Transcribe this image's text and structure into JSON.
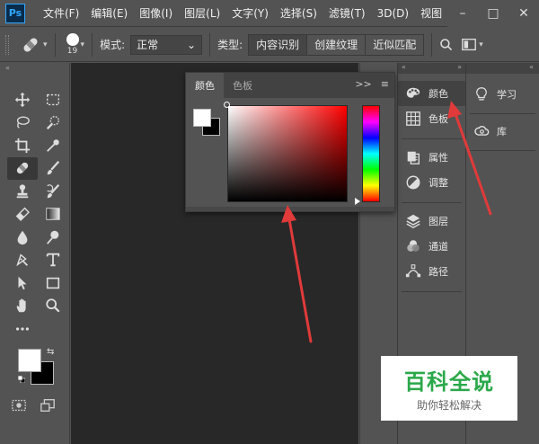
{
  "app": {
    "logo": "Ps"
  },
  "menu": [
    "文件(F)",
    "编辑(E)",
    "图像(I)",
    "图层(L)",
    "文字(Y)",
    "选择(S)",
    "滤镜(T)",
    "3D(D)",
    "视图"
  ],
  "window_buttons": [
    "–",
    "□",
    "✕"
  ],
  "options": {
    "brush_size": "19",
    "mode_label": "模式:",
    "mode_value": "正常",
    "type_label": "类型:",
    "type_options": [
      "内容识别",
      "创建纹理",
      "近似匹配"
    ],
    "type_selected": "内容识别"
  },
  "toolbar": {
    "collapse": "«",
    "tools": [
      "move-icon",
      "marquee-icon",
      "lasso-icon",
      "quick-select-icon",
      "crop-icon",
      "eyedropper-icon",
      "healing-brush-icon",
      "brush-icon",
      "stamp-icon",
      "history-brush-icon",
      "eraser-icon",
      "gradient-icon",
      "blur-icon",
      "dodge-icon",
      "pen-icon",
      "text-icon",
      "path-select-icon",
      "rectangle-icon",
      "hand-icon",
      "zoom-icon",
      "more-tools-icon"
    ],
    "active_tool": "healing-brush-icon",
    "foreground": "#ffffff",
    "background": "#000000"
  },
  "color_panel": {
    "tabs": [
      "颜色",
      "色板"
    ],
    "active_tab": "颜色",
    "expand": ">>",
    "menu": "≡",
    "foreground": "#ffffff",
    "background": "#000000",
    "hue": "#ff0000"
  },
  "dock1": {
    "collapse": "«",
    "expand": "»",
    "groups": [
      [
        {
          "name": "color",
          "label": "颜色",
          "icon": "palette-icon",
          "active": true
        },
        {
          "name": "swatches",
          "label": "色板",
          "icon": "grid-icon"
        }
      ],
      [
        {
          "name": "properties",
          "label": "属性",
          "icon": "properties-icon"
        },
        {
          "name": "adjustments",
          "label": "调整",
          "icon": "adjust-icon"
        }
      ],
      [
        {
          "name": "layers",
          "label": "图层",
          "icon": "layers-icon"
        },
        {
          "name": "channels",
          "label": "通道",
          "icon": "channels-icon"
        },
        {
          "name": "paths",
          "label": "路径",
          "icon": "paths-icon"
        }
      ]
    ]
  },
  "dock2": {
    "collapse": "«",
    "items": [
      {
        "name": "learn",
        "label": "学习",
        "icon": "lightbulb-icon"
      },
      {
        "name": "libraries",
        "label": "库",
        "icon": "cc-libraries-icon"
      }
    ]
  },
  "watermark": {
    "title": "百科全说",
    "subtitle": "助你轻松解决"
  },
  "annotation_color": "#e03a3a"
}
